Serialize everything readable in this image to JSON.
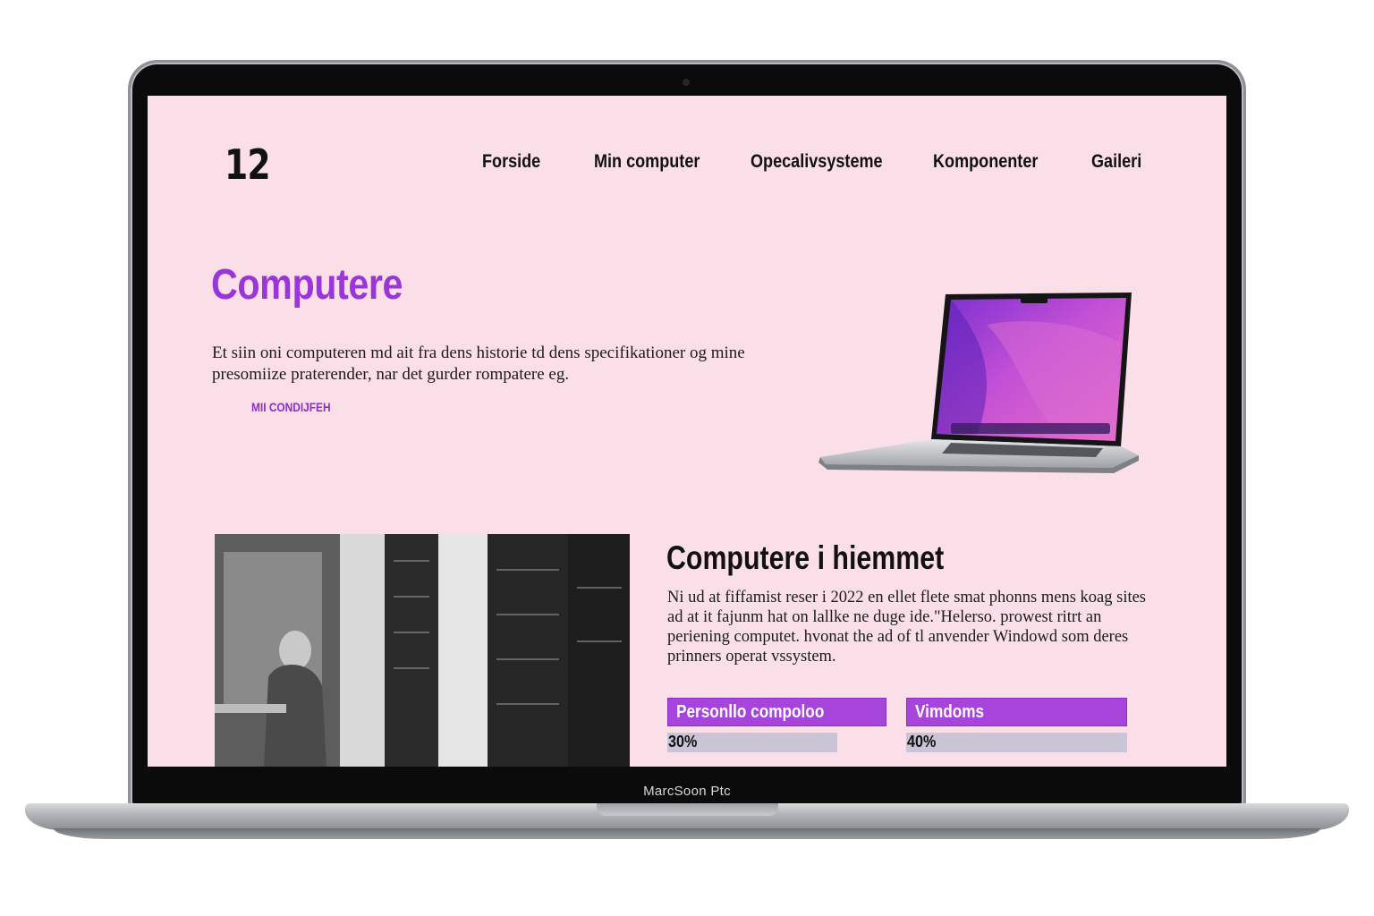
{
  "device": {
    "chin_label": "MarcSoon Ptc"
  },
  "site": {
    "logo": "12",
    "nav": [
      "Forside",
      "Min computer",
      "Opecalivsysteme",
      "Komponenter",
      "Gaileri"
    ]
  },
  "hero": {
    "title": "Computere",
    "text": "Et siin oni computeren md ait fra dens historie td dens specifikationer og mine presomiize praterender, nar det gurder rompatere eg.",
    "link": "MII CONDIJFEH"
  },
  "home_section": {
    "title": "Computere i hiemmet",
    "text": "Ni ud at fiffamist reser i 2022 en ellet flete smat phonns mens koag sites ad at it fajunm hat on lallke ne duge ide.\"Helerso. prowest ritrt an periening computet. hvonat the ad of tl anvender Windowd som deres prinners operat vssystem."
  },
  "stats": [
    {
      "label": "Personllo compoloo",
      "value": "30%",
      "fraction": 0.3
    },
    {
      "label": "Vimdoms",
      "value": "40%",
      "fraction": 0.4
    }
  ],
  "colors": {
    "page_bg": "#fbdfe8",
    "accent": "#9a36d8",
    "stat_bar": "#a744dc",
    "track": "#c9c5d6"
  }
}
